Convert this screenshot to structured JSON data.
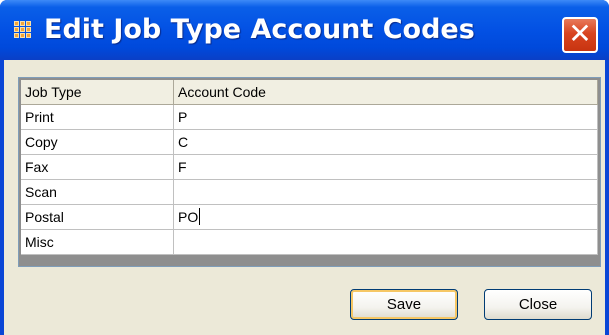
{
  "window": {
    "title": "Edit Job Type Account Codes",
    "close_glyph": "✕",
    "app_icon": "grid-app-icon"
  },
  "grid": {
    "columns": [
      "Job Type",
      "Account Code"
    ],
    "rows": [
      {
        "job_type": "Print",
        "account_code": "P"
      },
      {
        "job_type": "Copy",
        "account_code": "C"
      },
      {
        "job_type": "Fax",
        "account_code": "F"
      },
      {
        "job_type": "Scan",
        "account_code": ""
      },
      {
        "job_type": "Postal",
        "account_code": "PO"
      },
      {
        "job_type": "Misc",
        "account_code": ""
      }
    ],
    "editing_row": 4
  },
  "buttons": {
    "save_label": "Save",
    "close_label": "Close"
  },
  "colors": {
    "titlebar": "#0351e4",
    "close_button": "#d8441f",
    "dialog_face": "#ece9d8",
    "grid_background": "#8e8e8e"
  }
}
